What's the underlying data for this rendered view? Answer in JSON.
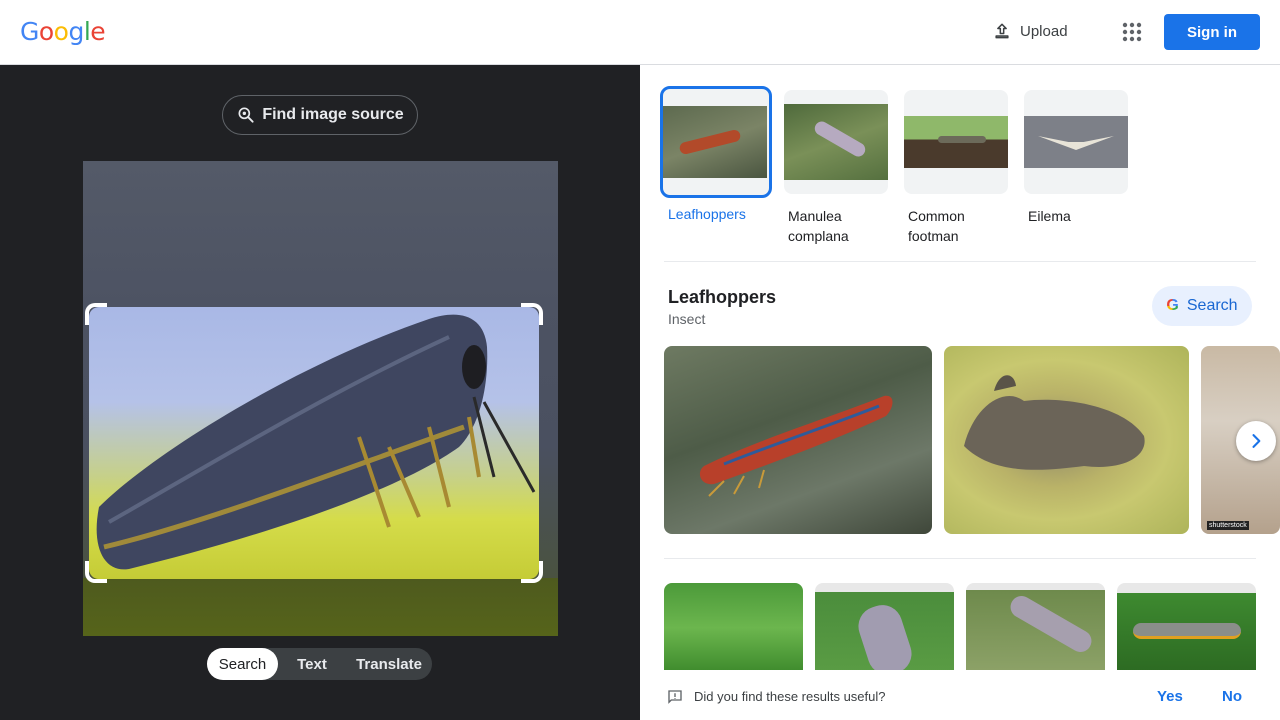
{
  "header": {
    "logo": [
      "G",
      "o",
      "o",
      "g",
      "l",
      "e"
    ],
    "upload_label": "Upload",
    "signin_label": "Sign in"
  },
  "left_panel": {
    "find_source_label": "Find image source",
    "modes": [
      "Search",
      "Text",
      "Translate"
    ],
    "active_mode": "Search"
  },
  "right_panel": {
    "chips": [
      {
        "label": "Leafhoppers",
        "selected": true
      },
      {
        "label": "Manulea complana",
        "selected": false
      },
      {
        "label": "Common footman",
        "selected": false
      },
      {
        "label": "Eilema",
        "selected": false
      }
    ],
    "entity": {
      "title": "Leafhoppers",
      "subtitle": "Insect",
      "search_label": "Search"
    },
    "watermark": "shutterstock"
  },
  "feedback": {
    "question": "Did you find these results useful?",
    "yes_label": "Yes",
    "no_label": "No"
  },
  "colors": {
    "accent": "#1a73e8",
    "dark_panel": "#202124"
  }
}
